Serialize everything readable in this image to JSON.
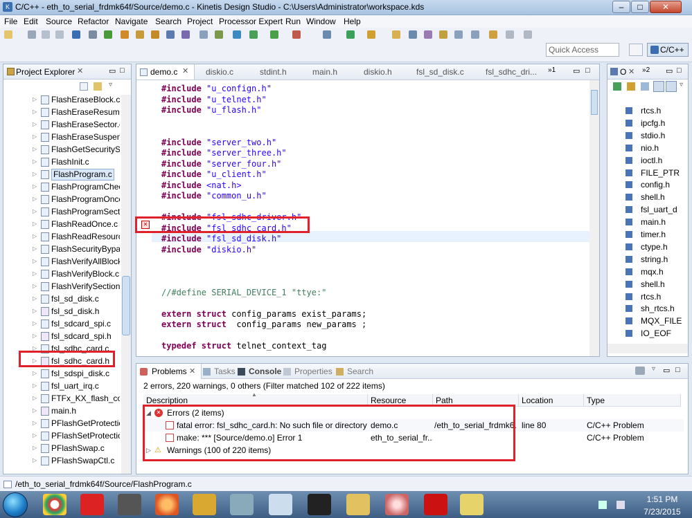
{
  "window": {
    "title": "C/C++ - eth_to_serial_frdmk64f/Source/demo.c - Kinetis Design Studio - C:\\Users\\Administrator\\workspace.kds"
  },
  "menu": [
    "File",
    "Edit",
    "Source",
    "Refactor",
    "Navigate",
    "Search",
    "Project",
    "Processor Expert",
    "Run",
    "Window",
    "Help"
  ],
  "toolbar": {
    "quick_access_placeholder": "Quick Access",
    "perspective": "C/C++"
  },
  "project_explorer": {
    "tab": "Project Explorer",
    "items": [
      "FlashEraseBlock.c",
      "FlashEraseResume.c",
      "FlashEraseSector.c",
      "FlashEraseSuspend.c",
      "FlashGetSecuritySta",
      "FlashInit.c",
      "FlashProgram.c",
      "FlashProgramCheck",
      "FlashProgramOnce.",
      "FlashProgramSectio",
      "FlashReadOnce.c",
      "FlashReadResource",
      "FlashSecurityBypass",
      "FlashVerifyAllBlock",
      "FlashVerifyBlock.c",
      "FlashVerifySection.c",
      "fsl_sd_disk.c",
      "fsl_sd_disk.h",
      "fsl_sdcard_spi.c",
      "fsl_sdcard_spi.h",
      "fsl_sdhc_card.c",
      "fsl_sdhc_card.h",
      "fsl_sdspi_disk.c",
      "fsl_uart_irq.c",
      "FTFx_KX_flash_confi",
      "main.h",
      "PFlashGetProtection",
      "PFlashSetProtection",
      "PFlashSwap.c",
      "PFlashSwapCtl.c"
    ],
    "selected": "FlashProgram.c",
    "highlighted": "fsl_sdhc_card.h"
  },
  "editor": {
    "tabs": [
      "demo.c",
      "diskio.c",
      "stdint.h",
      "main.h",
      "diskio.h",
      "fsl_sd_disk.c",
      "fsl_sdhc_dri..."
    ],
    "overflow_count": "1",
    "lines": [
      {
        "kw": "#include",
        "rest": " \"u_confign.h\""
      },
      {
        "kw": "#include",
        "rest": " \"u_telnet.h\""
      },
      {
        "kw": "#include",
        "rest": " \"u_flash.h\""
      },
      {
        "kw": "",
        "rest": ""
      },
      {
        "kw": "",
        "rest": ""
      },
      {
        "kw": "#include",
        "rest": " \"server_two.h\""
      },
      {
        "kw": "#include",
        "rest": " \"server_three.h\""
      },
      {
        "kw": "#include",
        "rest": " \"server_four.h\""
      },
      {
        "kw": "#include",
        "rest": " \"u_client.h\""
      },
      {
        "kw": "#include",
        "rest": " <nat.h>"
      },
      {
        "kw": "#include",
        "rest": " \"common_u.h\""
      },
      {
        "kw": "",
        "rest": ""
      },
      {
        "kw": "#include",
        "rest": " \"fsl_sdhc_driver.h\""
      },
      {
        "kw": "#include",
        "rest": " \"fsl_sdhc_card.h\""
      },
      {
        "kw": "#include",
        "rest": " \"fsl_sd_disk.h\""
      },
      {
        "kw": "#include",
        "rest": " \"diskio.h\""
      },
      {
        "kw": "",
        "rest": ""
      },
      {
        "kw": "",
        "rest": ""
      },
      {
        "kw": "",
        "rest": ""
      },
      {
        "kw": "",
        "rest": "//#define SERIAL_DEVICE_1 \"ttye:\""
      },
      {
        "kw": "",
        "rest": ""
      },
      {
        "kw": "extern struct",
        "rest": " config_params exist_params;"
      },
      {
        "kw": "extern struct",
        "rest": "  config_params new_params ;"
      },
      {
        "kw": "",
        "rest": ""
      },
      {
        "kw": "typedef struct",
        "rest": " telnet_context_tag"
      }
    ]
  },
  "outline": {
    "tab": "O",
    "overflow_count": "2",
    "items": [
      "rtcs.h",
      "ipcfg.h",
      "stdio.h",
      "nio.h",
      "ioctl.h",
      "FILE_PTR",
      "config.h",
      "shell.h",
      "fsl_uart_d",
      "main.h",
      "timer.h",
      "ctype.h",
      "string.h",
      "mqx.h",
      "shell.h",
      "rtcs.h",
      "sh_rtcs.h",
      "MQX_FILE",
      "IO_EOF"
    ]
  },
  "problems": {
    "tabs": [
      "Problems",
      "Tasks",
      "Console",
      "Properties",
      "Search"
    ],
    "summary": "2 errors, 220 warnings, 0 others (Filter matched 102 of 222 items)",
    "columns": [
      "Description",
      "Resource",
      "Path",
      "Location",
      "Type"
    ],
    "errors_group": "Errors (2 items)",
    "errors": [
      {
        "description": "fatal error: fsl_sdhc_card.h: No such file or directory",
        "resource": "demo.c",
        "path": "/eth_to_serial_frdmk6...",
        "location": "line 80",
        "type": "C/C++ Problem"
      },
      {
        "description": "make: *** [Source/demo.o] Error 1",
        "resource": "eth_to_serial_fr...",
        "path": "",
        "location": "",
        "type": "C/C++ Problem"
      }
    ],
    "warnings_group": "Warnings (100 of 220 items)"
  },
  "status_bar": {
    "text": "/eth_to_serial_frdmk64f/Source/FlashProgram.c"
  },
  "taskbar": {
    "time": "1:51 PM",
    "date": "7/23/2015"
  }
}
